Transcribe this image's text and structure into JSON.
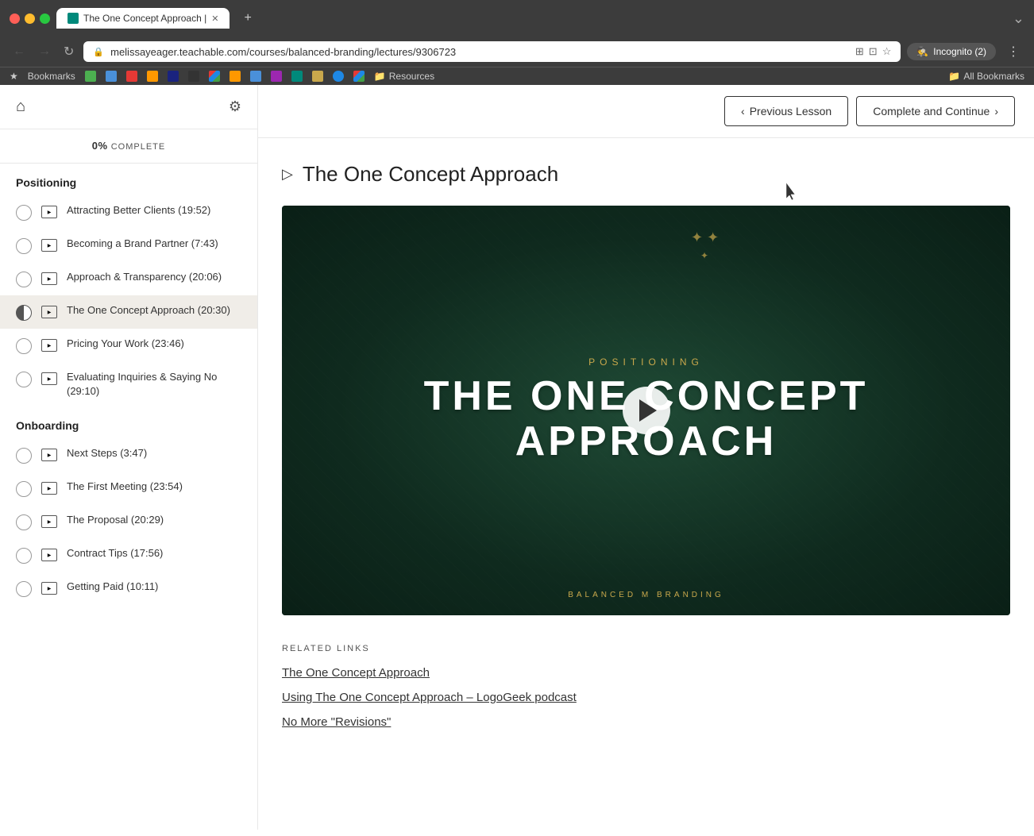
{
  "browser": {
    "tab_title": "The One Concept Approach |",
    "url": "melissayeager.teachable.com/courses/balanced-branding/lectures/9306723",
    "incognito_label": "Incognito (2)",
    "new_tab_icon": "+",
    "bookmarks_label": "Bookmarks",
    "all_bookmarks_label": "All Bookmarks",
    "resources_label": "Resources"
  },
  "sidebar": {
    "progress_percent": "0%",
    "progress_label": "COMPLETE",
    "sections": [
      {
        "title": "Positioning",
        "lessons": [
          {
            "id": "attracting",
            "title": "Attracting Better Clients (19:52)",
            "checked": false,
            "active": false
          },
          {
            "id": "becoming",
            "title": "Becoming a Brand Partner (7:43)",
            "checked": false,
            "active": false
          },
          {
            "id": "approach",
            "title": "Approach & Transparency (20:06)",
            "checked": false,
            "active": false
          },
          {
            "id": "one-concept",
            "title": "The One Concept Approach (20:30)",
            "checked": false,
            "active": true
          },
          {
            "id": "pricing",
            "title": "Pricing Your Work (23:46)",
            "checked": false,
            "active": false
          },
          {
            "id": "evaluating",
            "title": "Evaluating Inquiries & Saying No (29:10)",
            "checked": false,
            "active": false
          }
        ]
      },
      {
        "title": "Onboarding",
        "lessons": [
          {
            "id": "next-steps",
            "title": "Next Steps (3:47)",
            "checked": false,
            "active": false
          },
          {
            "id": "first-meeting",
            "title": "The First Meeting (23:54)",
            "checked": false,
            "active": false
          },
          {
            "id": "proposal",
            "title": "The Proposal (20:29)",
            "checked": false,
            "active": false
          },
          {
            "id": "contract",
            "title": "Contract Tips (17:56)",
            "checked": false,
            "active": false
          },
          {
            "id": "getting-paid",
            "title": "Getting Paid (10:11)",
            "checked": false,
            "active": false
          }
        ]
      }
    ]
  },
  "header": {
    "prev_label": "Previous Lesson",
    "continue_label": "Complete and Continue"
  },
  "main": {
    "page_title": "The One Concept Approach",
    "video": {
      "sub_text": "POSITIONING",
      "main_line1": "THE ONE CONCEPT",
      "main_line2": "APPROACH",
      "brand_text": "BALANCED    M    BRANDING"
    },
    "related_links_label": "RELATED LINKS",
    "links": [
      {
        "label": "The One Concept Approach"
      },
      {
        "label": "Using The One Concept Approach – LogoGeek podcast"
      },
      {
        "label": "No More \"Revisions\""
      }
    ]
  }
}
